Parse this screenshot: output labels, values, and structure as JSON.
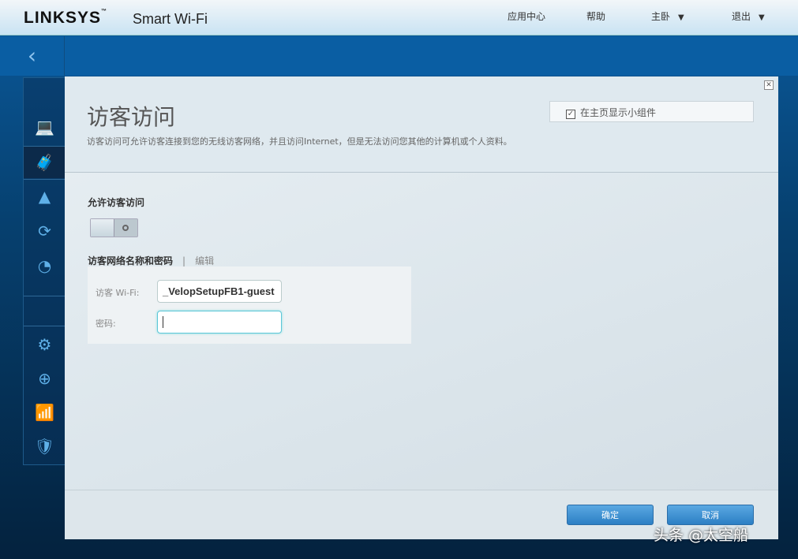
{
  "header": {
    "brand": "LINKSYS",
    "brand_tm": "™",
    "product": "Smart Wi-Fi",
    "nav": [
      "应用中心",
      "帮助",
      "主卧",
      "退出"
    ]
  },
  "page": {
    "title": "访客访问",
    "description": "访客访问可允许访客连接到您的无线访客网络，并且访问Internet，但是无法访问您其他的计算机或个人资料。",
    "widget_label": "在主页显示小组件",
    "widget_checked": true,
    "allow_label": "允许访客访问",
    "toggle_on": false,
    "network_label": "访客网络名称和密码",
    "divider": "|",
    "edit_label": "编辑",
    "wifi_label": "访客 Wi-Fi:",
    "wifi_value": "_VelopSetupFB1-guest",
    "password_label": "密码:",
    "password_value": "",
    "ok": "确定",
    "cancel": "取消"
  },
  "watermark": "头条 @太空船"
}
